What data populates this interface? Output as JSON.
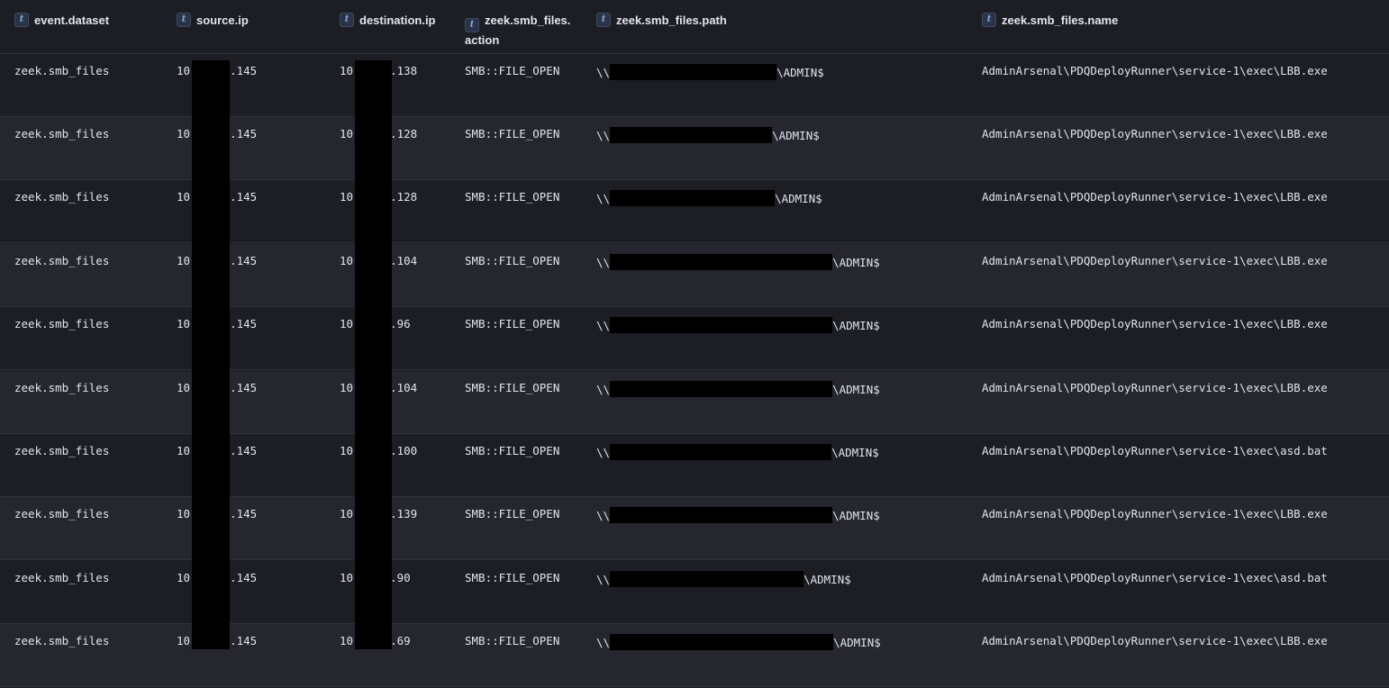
{
  "columns": [
    {
      "type": "t",
      "label": "event.dataset"
    },
    {
      "type": "t",
      "label": "source.ip"
    },
    {
      "type": "t",
      "label": "destination.ip"
    },
    {
      "type": "t",
      "label": "zeek.smb_files. action"
    },
    {
      "type": "t",
      "label": "zeek.smb_files.path"
    },
    {
      "type": "t",
      "label": "zeek.smb_files.name"
    }
  ],
  "rows": [
    {
      "dataset": "zeek.smb_files",
      "src_prefix": "10",
      "src_suffix": ".145",
      "dst_prefix": "10",
      "dst_suffix": ".138",
      "action": "SMB::FILE_OPEN",
      "path_prefix": "\\\\",
      "path_suffix": "\\ADMIN$",
      "name": "AdminArsenal\\PDQDeployRunner\\service-1\\exec\\LBB.exe"
    },
    {
      "dataset": "zeek.smb_files",
      "src_prefix": "10",
      "src_suffix": ".145",
      "dst_prefix": "10",
      "dst_suffix": ".128",
      "action": "SMB::FILE_OPEN",
      "path_prefix": "\\\\",
      "path_suffix": "\\ADMIN$",
      "name": "AdminArsenal\\PDQDeployRunner\\service-1\\exec\\LBB.exe"
    },
    {
      "dataset": "zeek.smb_files",
      "src_prefix": "10",
      "src_suffix": ".145",
      "dst_prefix": "10",
      "dst_suffix": ".128",
      "action": "SMB::FILE_OPEN",
      "path_prefix": "\\\\",
      "path_suffix": "\\ADMIN$",
      "name": "AdminArsenal\\PDQDeployRunner\\service-1\\exec\\LBB.exe"
    },
    {
      "dataset": "zeek.smb_files",
      "src_prefix": "10",
      "src_suffix": ".145",
      "dst_prefix": "10",
      "dst_suffix": ".104",
      "action": "SMB::FILE_OPEN",
      "path_prefix": "\\\\",
      "path_suffix": "\\ADMIN$",
      "name": "AdminArsenal\\PDQDeployRunner\\service-1\\exec\\LBB.exe"
    },
    {
      "dataset": "zeek.smb_files",
      "src_prefix": "10",
      "src_suffix": ".145",
      "dst_prefix": "10",
      "dst_suffix": ".96",
      "action": "SMB::FILE_OPEN",
      "path_prefix": "\\\\",
      "path_suffix": "\\ADMIN$",
      "name": "AdminArsenal\\PDQDeployRunner\\service-1\\exec\\LBB.exe"
    },
    {
      "dataset": "zeek.smb_files",
      "src_prefix": "10",
      "src_suffix": ".145",
      "dst_prefix": "10",
      "dst_suffix": ".104",
      "action": "SMB::FILE_OPEN",
      "path_prefix": "\\\\",
      "path_suffix": "\\ADMIN$",
      "name": "AdminArsenal\\PDQDeployRunner\\service-1\\exec\\LBB.exe"
    },
    {
      "dataset": "zeek.smb_files",
      "src_prefix": "10",
      "src_suffix": ".145",
      "dst_prefix": "10",
      "dst_suffix": ".100",
      "action": "SMB::FILE_OPEN",
      "path_prefix": "\\\\",
      "path_suffix": "\\ADMIN$",
      "name": "AdminArsenal\\PDQDeployRunner\\service-1\\exec\\asd.bat"
    },
    {
      "dataset": "zeek.smb_files",
      "src_prefix": "10",
      "src_suffix": ".145",
      "dst_prefix": "10",
      "dst_suffix": ".139",
      "action": "SMB::FILE_OPEN",
      "path_prefix": "\\\\",
      "path_suffix": "\\ADMIN$",
      "name": "AdminArsenal\\PDQDeployRunner\\service-1\\exec\\LBB.exe"
    },
    {
      "dataset": "zeek.smb_files",
      "src_prefix": "10",
      "src_suffix": ".145",
      "dst_prefix": "10",
      "dst_suffix": ".90",
      "action": "SMB::FILE_OPEN",
      "path_prefix": "\\\\",
      "path_suffix": "\\ADMIN$",
      "name": "AdminArsenal\\PDQDeployRunner\\service-1\\exec\\asd.bat"
    },
    {
      "dataset": "zeek.smb_files",
      "src_prefix": "10",
      "src_suffix": ".145",
      "dst_prefix": "10",
      "dst_suffix": ".69",
      "action": "SMB::FILE_OPEN",
      "path_prefix": "\\\\",
      "path_suffix": "\\ADMIN$",
      "name": "AdminArsenal\\PDQDeployRunner\\service-1\\exec\\LBB.exe"
    }
  ]
}
